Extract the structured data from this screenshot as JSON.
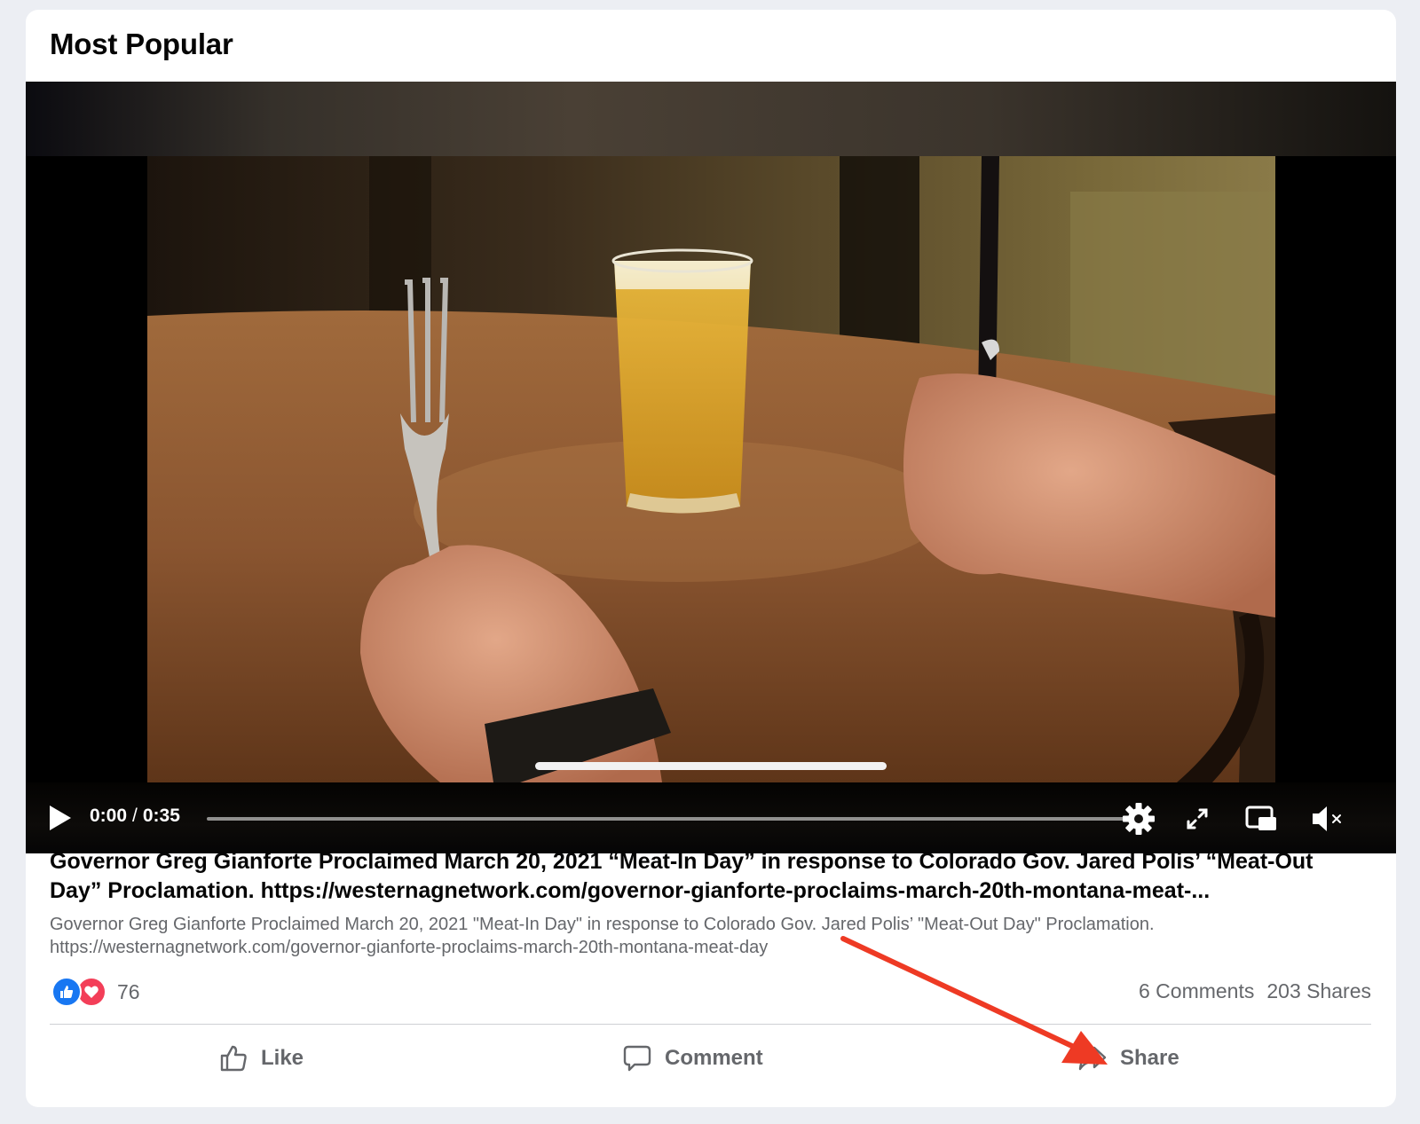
{
  "section": {
    "title": "Most Popular"
  },
  "video": {
    "current_time": "0:00",
    "separator": "/",
    "duration": "0:35",
    "progress": 0,
    "controls": [
      "play-icon",
      "gear-icon",
      "fullscreen-icon",
      "picture-in-picture-icon",
      "volume-muted-icon"
    ]
  },
  "post": {
    "title": "Governor Greg Gianforte Proclaimed March 20, 2021 “Meat-In Day” in response to Colorado Gov. Jared Polis’ “Meat-Out Day” Proclamation. https://westernagnetwork.com/governor-gianforte-proclaims-march-20th-montana-meat-...",
    "description": "Governor Greg Gianforte Proclaimed March 20, 2021 \"Meat-In Day\" in response to Colorado Gov. Jared Polis’ \"Meat-Out Day\" Proclamation. https://westernagnetwork.com/governor-gianforte-proclaims-march-20th-montana-meat-day"
  },
  "stats": {
    "reaction_count": "76",
    "reaction_types": [
      "like",
      "love"
    ],
    "comments": "6 Comments",
    "shares": "203 Shares"
  },
  "actions": {
    "like": "Like",
    "comment": "Comment",
    "share": "Share"
  },
  "colors": {
    "accent": "#1877f2",
    "love": "#f33e58",
    "annotation_arrow": "#ee3a24",
    "muted_text": "#65676b"
  }
}
